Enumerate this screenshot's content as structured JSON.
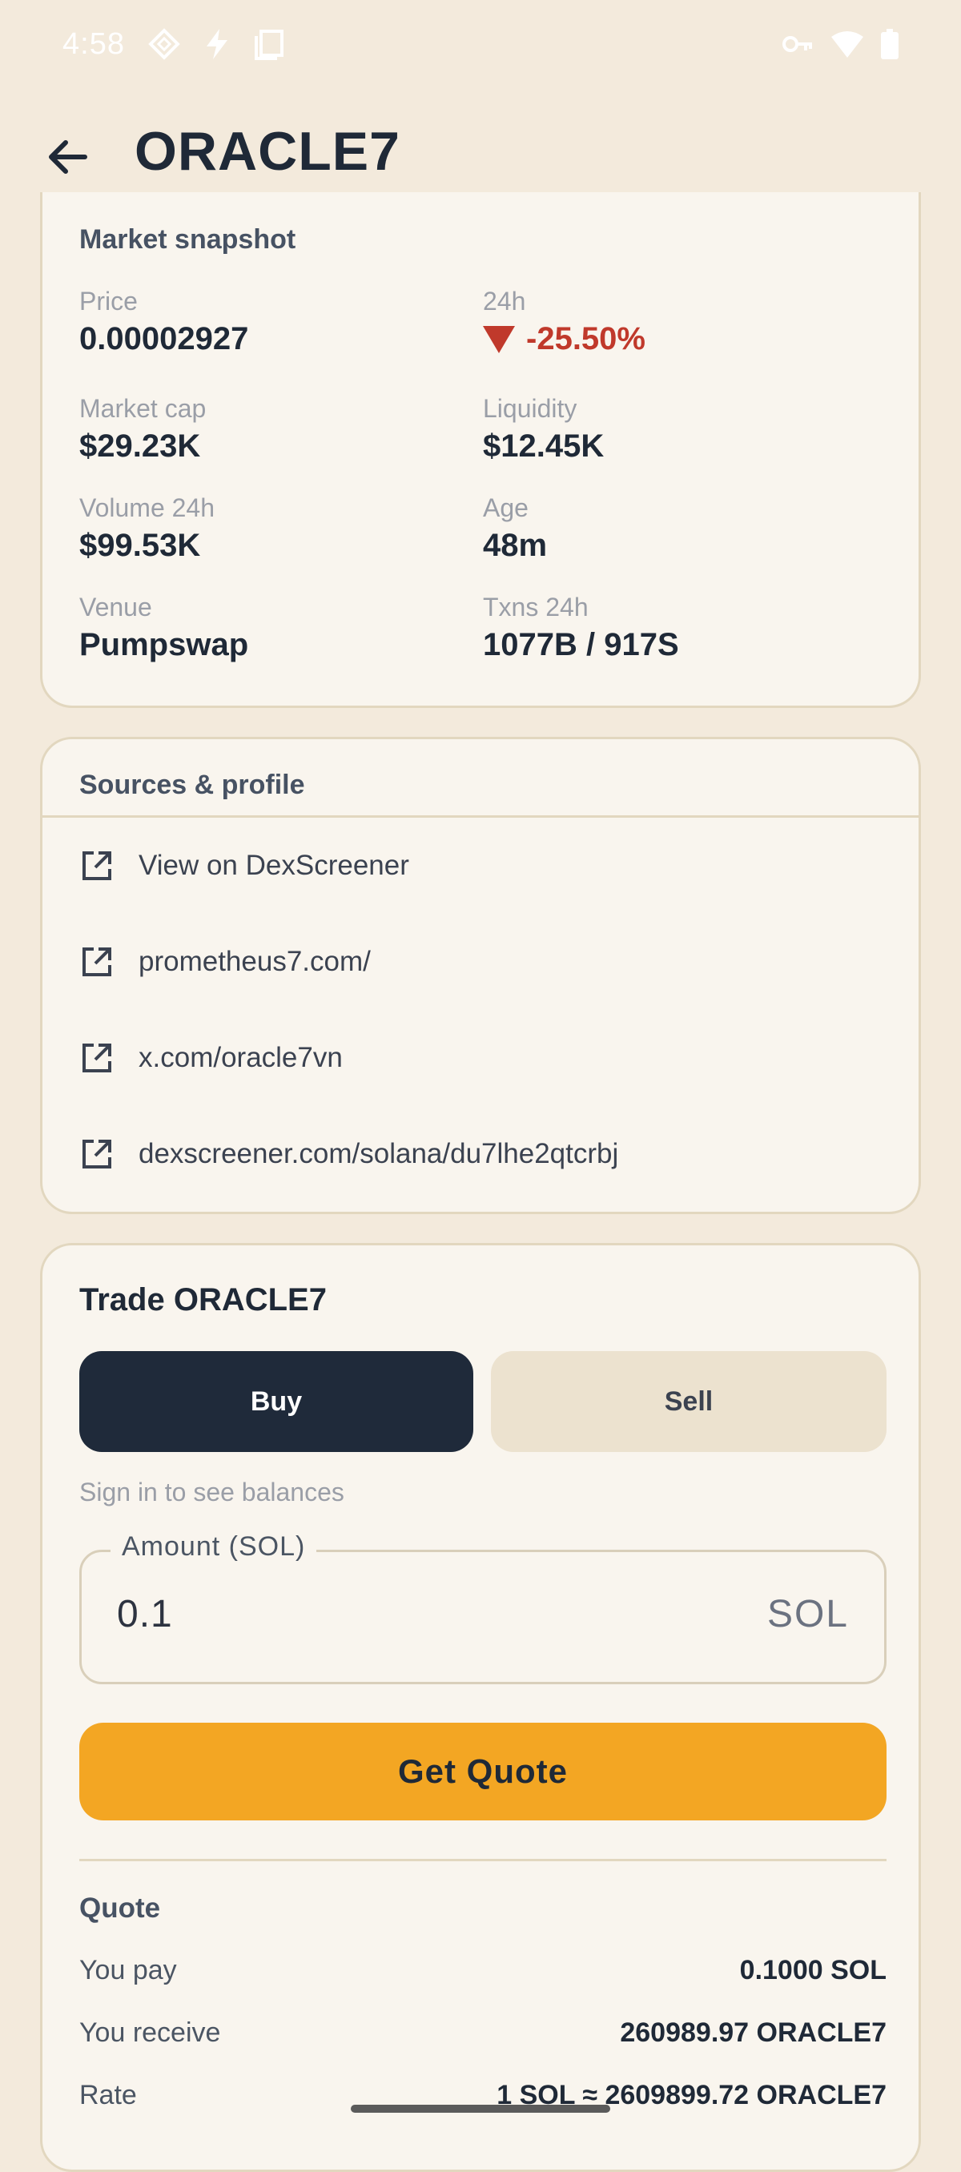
{
  "status_bar": {
    "time": "4:58"
  },
  "header": {
    "title": "ORACLE7"
  },
  "snapshot": {
    "title": "Market snapshot",
    "price_label": "Price",
    "price": "0.00002927",
    "change_label": "24h",
    "change": "-25.50%",
    "mcap_label": "Market cap",
    "mcap": "$29.23K",
    "liq_label": "Liquidity",
    "liq": "$12.45K",
    "vol_label": "Volume 24h",
    "vol": "$99.53K",
    "age_label": "Age",
    "age": "48m",
    "venue_label": "Venue",
    "venue": "Pumpswap",
    "txns_label": "Txns 24h",
    "txns": "1077B / 917S"
  },
  "sources": {
    "title": "Sources & profile",
    "items": [
      {
        "label": "View on DexScreener"
      },
      {
        "label": "prometheus7.com/"
      },
      {
        "label": "x.com/oracle7vn"
      },
      {
        "label": "dexscreener.com/solana/du7lhe2qtcrbj"
      }
    ]
  },
  "trade": {
    "title": "Trade ORACLE7",
    "buy_label": "Buy",
    "sell_label": "Sell",
    "hint": "Sign in to see balances",
    "amount_label": "Amount (SOL)",
    "amount_value": "0.1",
    "amount_suffix": "SOL",
    "quote_button": "Get Quote",
    "quote_title": "Quote",
    "rows": [
      {
        "label": "You pay",
        "value": "0.1000 SOL"
      },
      {
        "label": "You receive",
        "value": "260989.97 ORACLE7"
      },
      {
        "label": "Rate",
        "value": "1 SOL ≈ 2609899.72 ORACLE7"
      }
    ]
  },
  "colors": {
    "accent": "#f3a623",
    "negative": "#c0392b",
    "dark": "#1f2a3a",
    "background": "#f3eadc"
  }
}
